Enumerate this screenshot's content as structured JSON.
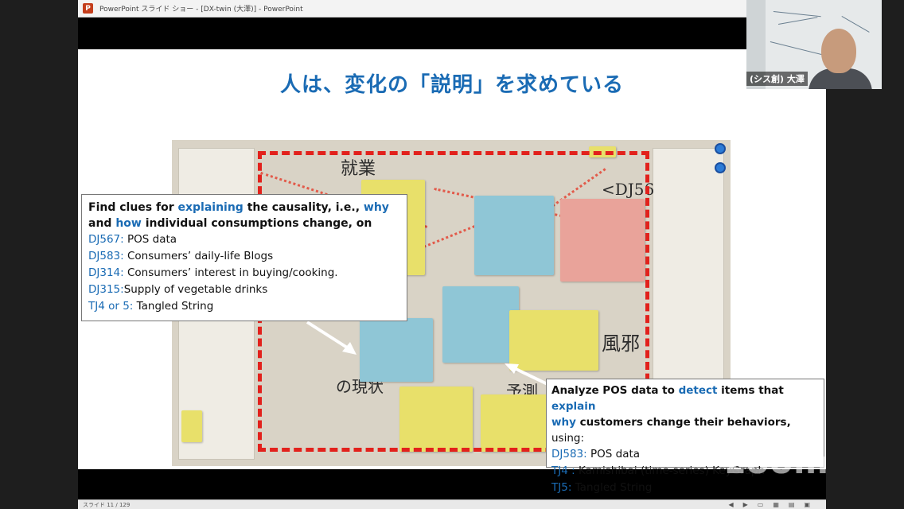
{
  "window": {
    "title": "PowerPoint スライド ショー - [DX-twin (大澤)] - PowerPoint",
    "app_icon_letter": "P"
  },
  "slide": {
    "title": "人は、変化の「説明」を求めている",
    "photo_marks": {
      "top_left": "就業",
      "dj56": "<DJ56",
      "bottom": "の現状",
      "kaze": "風邪",
      "yoho": "予測"
    },
    "callout_left": {
      "line1": [
        "Find clues for ",
        "explaining",
        " the causality, i.e., ",
        "why"
      ],
      "line2": [
        "and ",
        "how",
        " individual consumptions change, on"
      ],
      "items": [
        {
          "key": "DJ567:",
          "text": " POS data"
        },
        {
          "key": "DJ583:",
          "text": " Consumers’ daily-life Blogs"
        },
        {
          "key": "DJ314:",
          "text": " Consumers’ interest in buying/cooking."
        },
        {
          "key": "DJ315:",
          "text": "Supply of vegetable drinks"
        },
        {
          "key": "TJ4 or 5:",
          "text": " Tangled String"
        }
      ]
    },
    "callout_right": {
      "line1": [
        "Analyze POS data to ",
        "detect",
        " items that ",
        "explain"
      ],
      "line2": [
        "why",
        " customers change their behaviors,",
        " using:"
      ],
      "items": [
        {
          "key": "DJ583:",
          "text": " POS data"
        },
        {
          "key": "TJ4 :",
          "text": " Kamishibai (time-series) KeyGraph"
        },
        {
          "key": "TJ5:",
          "text": " Tangled String"
        }
      ]
    }
  },
  "statusbar": {
    "slide_counter": "スライド 11 / 129"
  },
  "webcam": {
    "name": "(シス創) 大澤"
  },
  "watermark": "zoom",
  "colors": {
    "accent_blue": "#1a6bb4",
    "dash_red": "#e2211c"
  }
}
